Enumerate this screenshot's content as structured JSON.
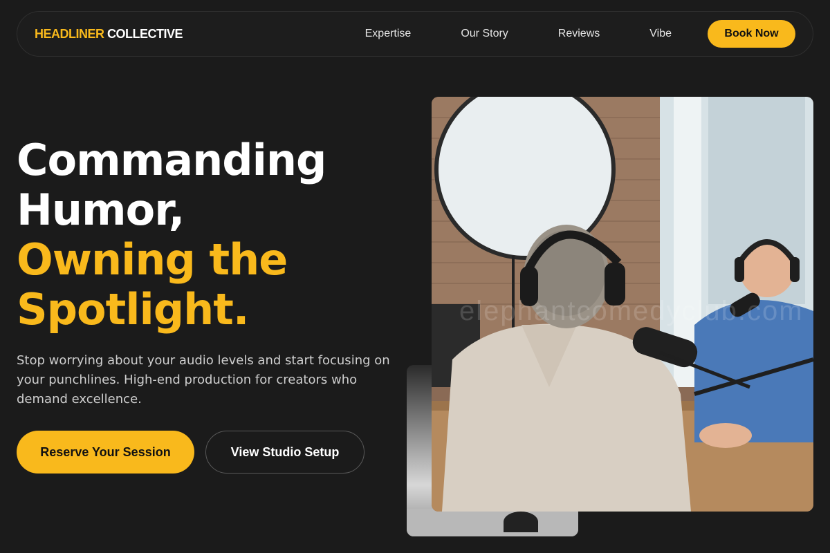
{
  "brand": {
    "accent": "HEADLINER",
    "rest": "COLLECTIVE"
  },
  "nav": {
    "links": [
      "Expertise",
      "Our Story",
      "Reviews",
      "Vibe"
    ],
    "cta": "Book Now"
  },
  "hero": {
    "headline_white": [
      "Commanding",
      "Humor,"
    ],
    "headline_gold": [
      "Owning the",
      "Spotlight."
    ],
    "subtext": "Stop worrying about your audio levels and start focusing on your punchlines. High-end production for creators who demand excellence.",
    "primary_button": "Reserve Your Session",
    "secondary_button": "View Studio Setup"
  },
  "image": {
    "watermark": "elephantcomedyclub.com",
    "icons": [
      "studio-photo",
      "podcast-hosts-photo"
    ]
  },
  "colors": {
    "accent": "#f9b91c",
    "background": "#1b1b1b"
  }
}
